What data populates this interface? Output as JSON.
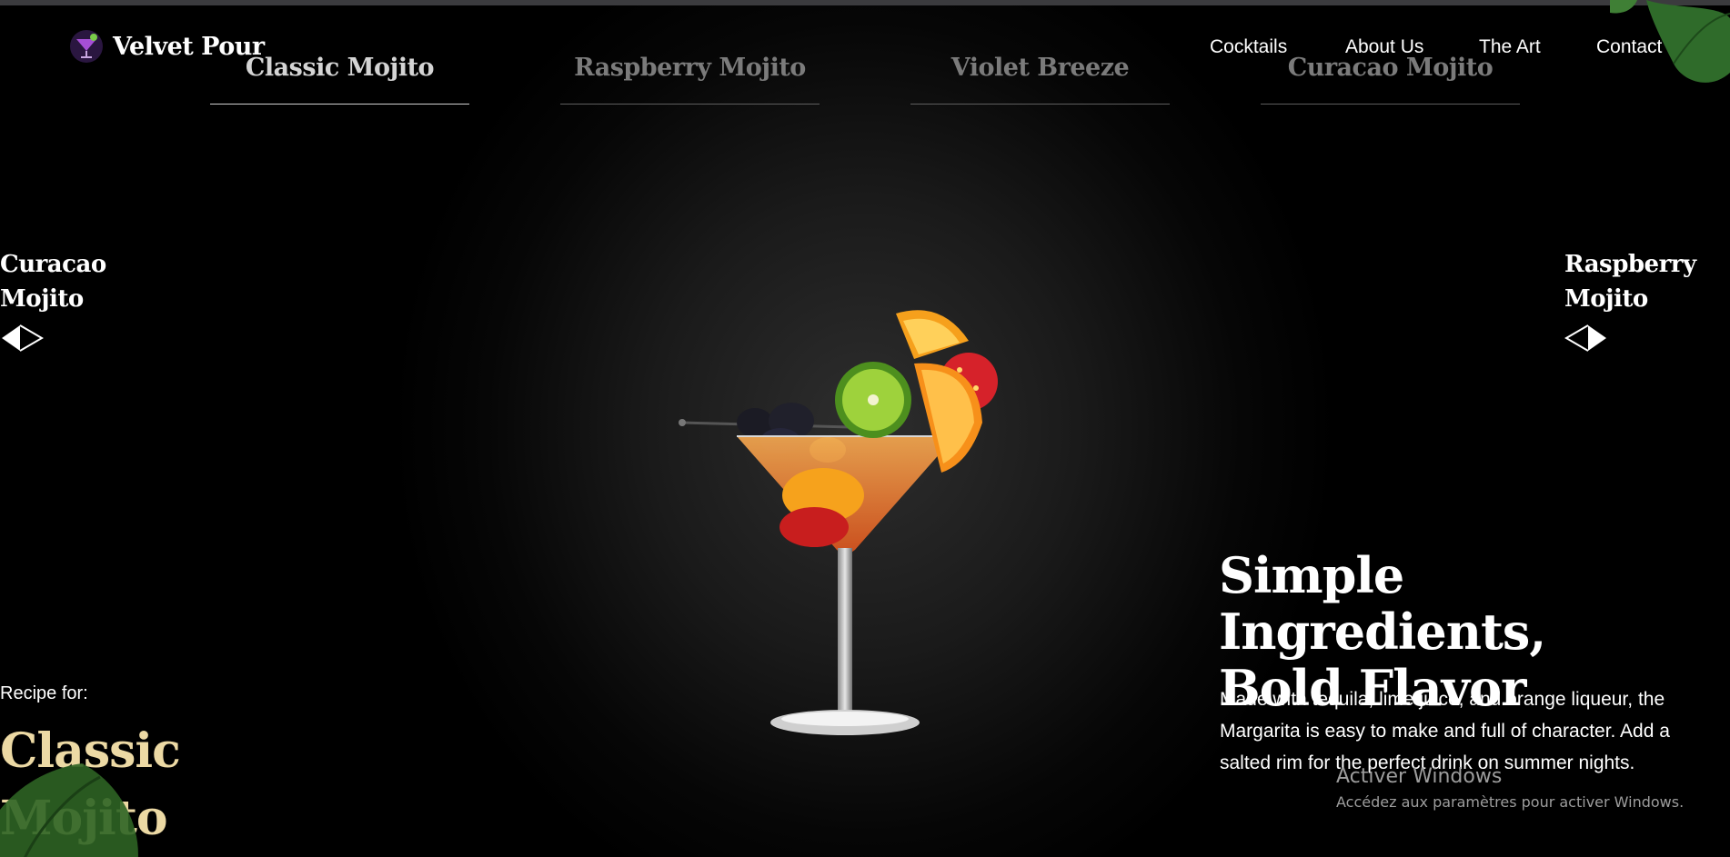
{
  "brand": {
    "name": "Velvet Pour",
    "logo_icon": "cocktail-glass-icon"
  },
  "nav": {
    "items": [
      "Cocktails",
      "About Us",
      "The Art",
      "Contact"
    ]
  },
  "tabs": {
    "items": [
      "Classic Mojito",
      "Raspberry Mojito",
      "Violet Breeze",
      "Curacao Mojito"
    ],
    "active": "Classic Mojito"
  },
  "prev": {
    "label_line1": "Curacao",
    "label_line2": "Mojito",
    "icon": "arrow-left-icon"
  },
  "next": {
    "label_line1": "Raspberry",
    "label_line2": "Mojito",
    "icon": "arrow-right-icon"
  },
  "recipe": {
    "label": "Recipe for:",
    "name_line1": "Classic",
    "name_line2": "Mojito"
  },
  "feature": {
    "title_line1": "Simple Ingredients,",
    "title_line2": "Bold Flavor",
    "description": "Made with tequila, lime juice, and orange liqueur, the Margarita is easy to make and full of character. Add a salted rim for the perfect drink on summer nights."
  },
  "watermark": {
    "title": "Activer Windows",
    "subtitle": "Accédez aux paramètres pour activer Windows."
  },
  "colors": {
    "background": "#000000",
    "accent_gold": "#ecd9a4",
    "tab_inactive": "#7b7b7b"
  }
}
